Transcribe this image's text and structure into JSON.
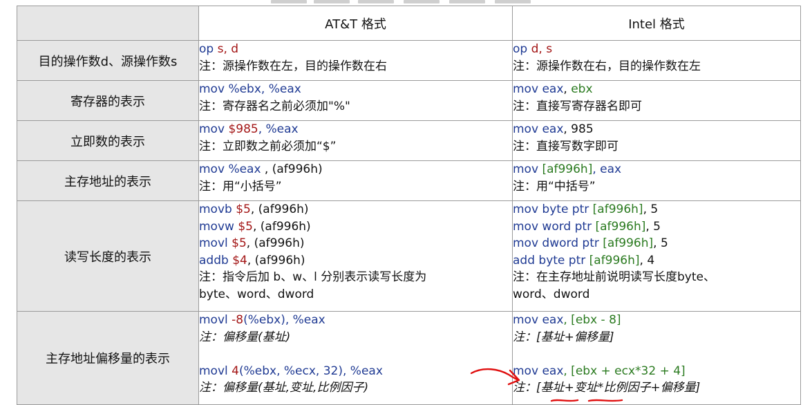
{
  "header": {
    "col_att": "AT&T 格式",
    "col_intel": "Intel 格式"
  },
  "rows": [
    {
      "category": "目的操作数d、源操作数s",
      "att": {
        "op": "op",
        "args": "s, d",
        "note": "注：源操作数在左，目的操作数在右"
      },
      "intel": {
        "op": "op",
        "args": "d, s",
        "note": "注：源操作数在右，目的操作数在左"
      }
    },
    {
      "category": "寄存器的表示",
      "att": {
        "op": "mov",
        "args": "%ebx, %eax",
        "note": "注：寄存器名之前必须加\"%\""
      },
      "intel": {
        "op": "mov",
        "arg1": "eax",
        "comma": ",",
        "arg2": "ebx",
        "note": "注：直接写寄存器名即可"
      }
    },
    {
      "category": "立即数的表示",
      "att": {
        "op": "mov",
        "arg1": "$985",
        "rest": ", %eax",
        "note": "注：立即数之前必须加“$”"
      },
      "intel": {
        "op": "mov",
        "arg1": "eax",
        "rest": ", 985",
        "note": "注：直接写数字即可"
      }
    },
    {
      "category": "主存地址的表示",
      "att": {
        "op": "mov",
        "arg1": "%eax",
        "rest": " , (af996h)",
        "note": "注：用“小括号”"
      },
      "intel": {
        "op": "mov",
        "arg1": "[af996h]",
        "rest": ", eax",
        "note": "注：用“中括号”"
      }
    },
    {
      "category": "读写长度的表示",
      "att": {
        "lines": [
          {
            "op": "movb",
            "imm": "$5",
            "rest": ", (af996h)"
          },
          {
            "op": "movw",
            "imm": "$5",
            "rest": ", (af996h)"
          },
          {
            "op": "movl",
            "imm": "$5",
            "rest": ", (af996h)"
          },
          {
            "op": "addb",
            "imm": "$4",
            "rest": ", (af996h)"
          }
        ],
        "note1": "注：指令后加 b、w、l 分别表示读写长度为",
        "note2": "byte、word、dword"
      },
      "intel": {
        "lines": [
          {
            "op": "mov byte ptr",
            "mem": "[af996h]",
            "rest": ", 5"
          },
          {
            "op": "mov word ptr",
            "mem": "[af996h]",
            "rest": ", 5"
          },
          {
            "op": "mov dword ptr",
            "mem": "[af996h]",
            "rest": ", 5"
          },
          {
            "op": "add byte ptr",
            "mem": "[af996h]",
            "rest": ", 4"
          }
        ],
        "note1": "注：在主存地址前说明读写长度byte、",
        "note2": "word、dword"
      }
    },
    {
      "category": "主存地址偏移量的表示",
      "att": {
        "l1_op": "movl",
        "l1_off": "-8",
        "l1_rest": "(%ebx), %eax",
        "l1_note": "注：偏移量(基址)",
        "l2_op": "movl",
        "l2_off": "4",
        "l2_rest": "(%ebx, %ecx, 32), %eax",
        "l2_note": "注：偏移量(基址,变址,比例因子)"
      },
      "intel": {
        "l1_op": "mov",
        "l1_reg": "eax",
        "l1_mem": ", [ebx - 8]",
        "l1_note": "注：[基址+偏移量]",
        "l2_op": "mov",
        "l2_reg": "eax",
        "l2_mem": ", [ebx + ecx*32 + 4]",
        "l2_note": "注：[基址+变址*比例因子+偏移量]"
      }
    }
  ],
  "colors": {
    "keyword": "#1f3a93",
    "operand_red": "#a31515",
    "operand_green": "#2a7a1f",
    "category_bg": "#e6e6e6",
    "annotation_red": "#e01010"
  }
}
